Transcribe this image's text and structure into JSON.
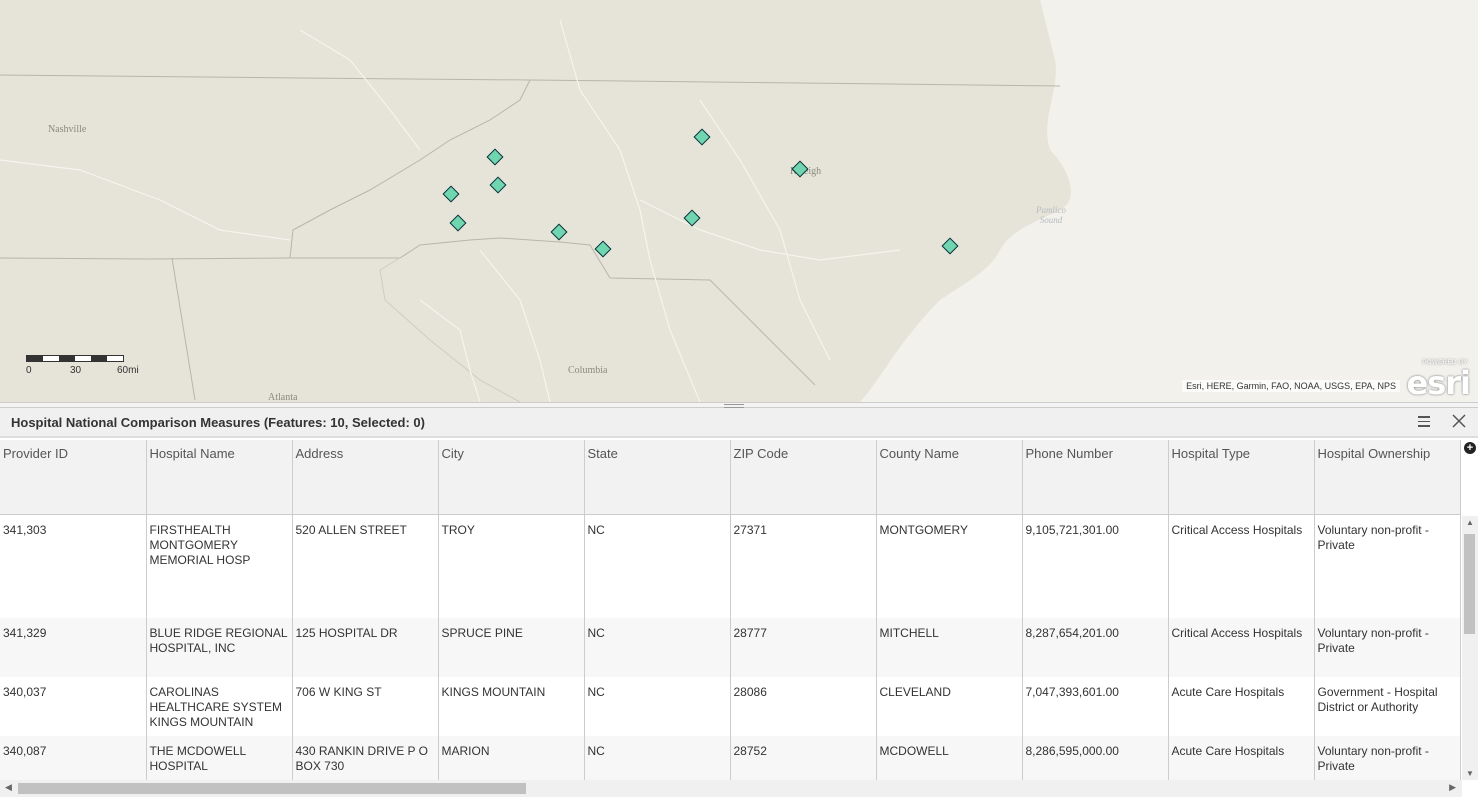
{
  "map": {
    "city_labels": [
      {
        "name": "Nashville"
      },
      {
        "name": "Raleigh"
      },
      {
        "name": "Columbia"
      },
      {
        "name": "Atlanta"
      }
    ],
    "water_label": "Pamlico\nSound",
    "scale": {
      "labels": [
        "0",
        "30",
        "60mi"
      ]
    },
    "attribution": "Esri, HERE, Garmin, FAO, NOAA, USGS, EPA, NPS",
    "logo": {
      "powered_by": "POWERED BY",
      "word": "esri"
    },
    "marker_color": "#6fd6b0",
    "marker_count": 10
  },
  "panel": {
    "title": "Hospital National Comparison Measures (Features: 10, Selected: 0)"
  },
  "table": {
    "columns": [
      "Provider ID",
      "Hospital Name",
      "Address",
      "City",
      "State",
      "ZIP Code",
      "County Name",
      "Phone Number",
      "Hospital Type",
      "Hospital Ownership"
    ],
    "rows": [
      [
        "341,303",
        "FIRSTHEALTH MONTGOMERY MEMORIAL HOSP",
        "520 ALLEN STREET",
        "TROY",
        "NC",
        "27371",
        "MONTGOMERY",
        "9,105,721,301.00",
        "Critical Access Hospitals",
        "Voluntary non-profit - Private"
      ],
      [
        "341,329",
        "BLUE RIDGE REGIONAL HOSPITAL, INC",
        "125 HOSPITAL DR",
        "SPRUCE PINE",
        "NC",
        "28777",
        "MITCHELL",
        "8,287,654,201.00",
        "Critical Access Hospitals",
        "Voluntary non-profit - Private"
      ],
      [
        "340,037",
        "CAROLINAS HEALTHCARE SYSTEM KINGS MOUNTAIN",
        "706 W KING ST",
        "KINGS MOUNTAIN",
        "NC",
        "28086",
        "CLEVELAND",
        "7,047,393,601.00",
        "Acute Care Hospitals",
        "Government - Hospital District or Authority"
      ],
      [
        "340,087",
        "THE MCDOWELL HOSPITAL",
        "430 RANKIN DRIVE P O BOX 730",
        "MARION",
        "NC",
        "28752",
        "MCDOWELL",
        "8,286,595,000.00",
        "Acute Care Hospitals",
        "Voluntary non-profit - Private"
      ]
    ]
  },
  "colors": {
    "map_land": "#e6e4d8",
    "map_water": "#f2f1ec",
    "header_bg": "#f0f0f0"
  }
}
